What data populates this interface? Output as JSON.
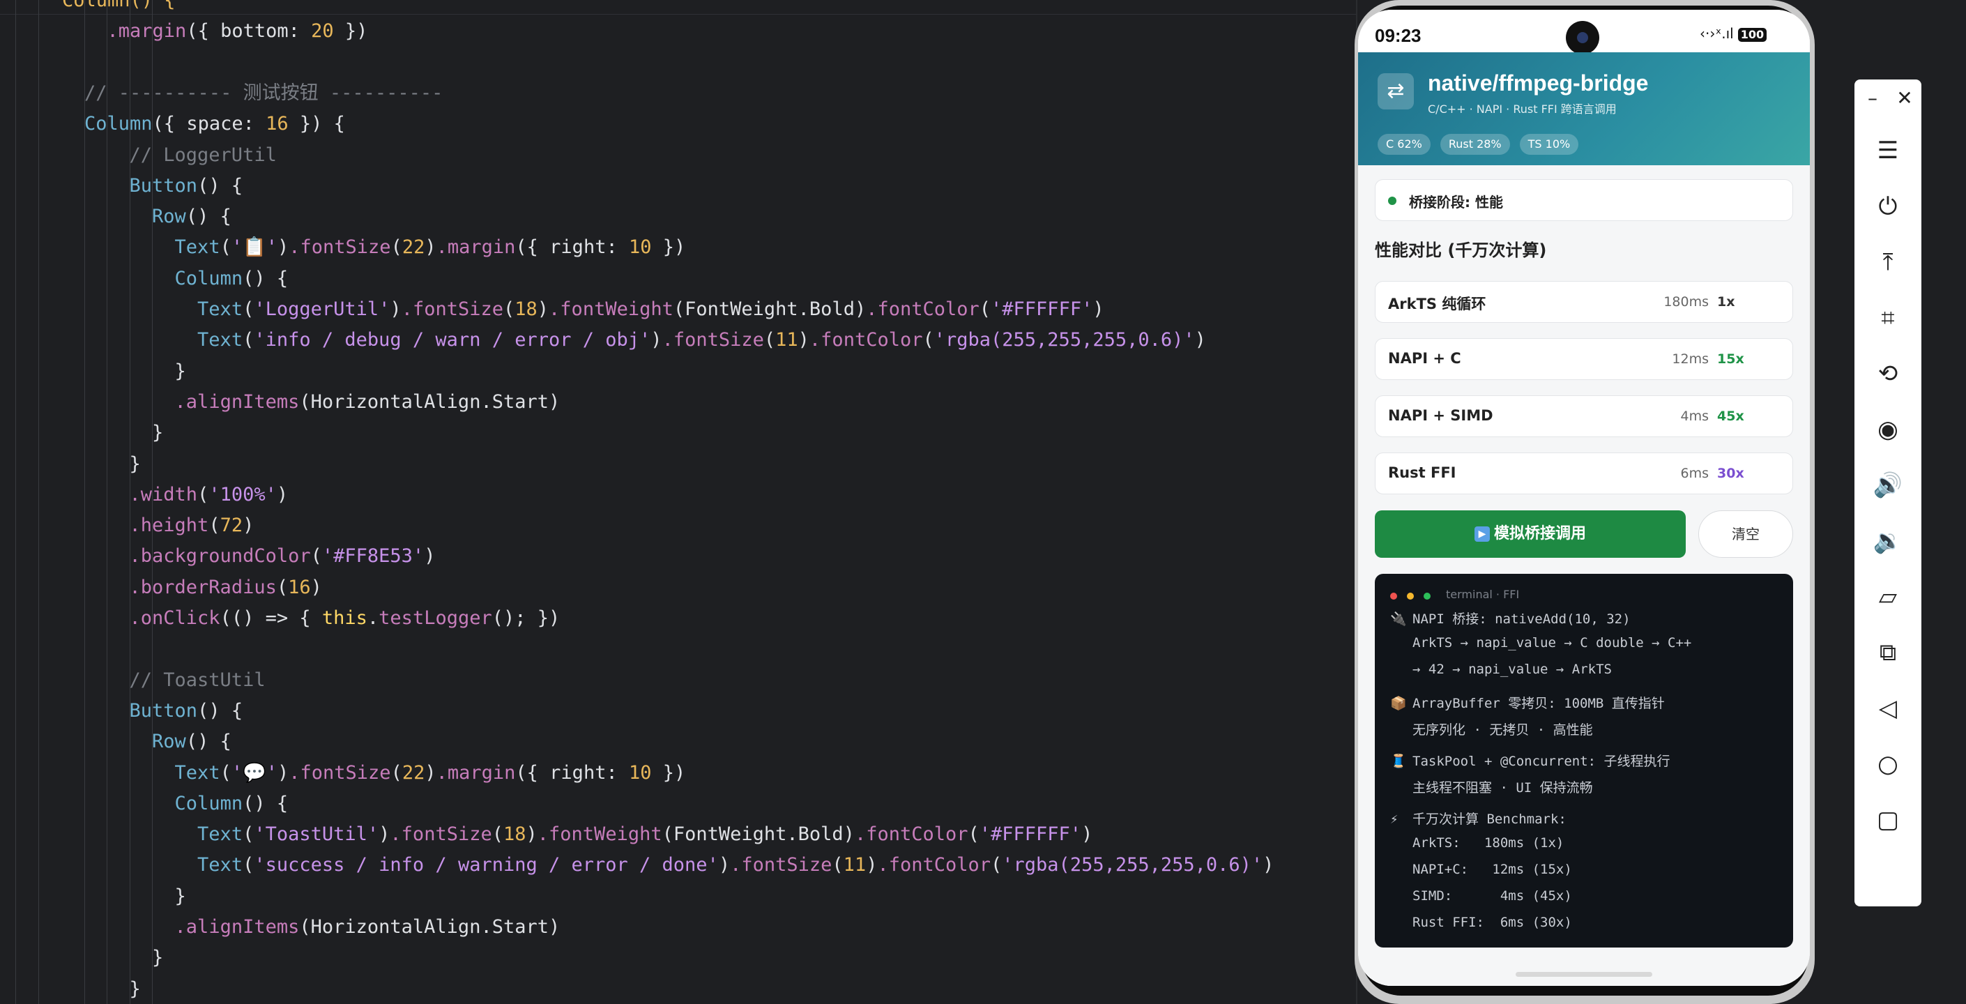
{
  "editor": {
    "lines": [
      [
        [
          "p",
          "Column() {"
        ]
      ],
      [
        [
          "w",
          "  "
        ],
        [
          "m",
          ".margin"
        ],
        [
          "w",
          "({ "
        ],
        [
          "w",
          "bottom"
        ],
        [
          "w",
          ": "
        ],
        [
          "n",
          "20"
        ],
        [
          "w",
          " })"
        ]
      ],
      [],
      [
        [
          "cm",
          "// ---------- 测试按钮 ----------"
        ]
      ],
      [
        [
          "k",
          "Column"
        ],
        [
          "w",
          "({ "
        ],
        [
          "w",
          "space"
        ],
        [
          "w",
          ": "
        ],
        [
          "n",
          "16"
        ],
        [
          "w",
          " }) {"
        ]
      ],
      [
        [
          "cm",
          "  // LoggerUtil"
        ]
      ],
      [
        [
          "w",
          "  "
        ],
        [
          "k",
          "Button"
        ],
        [
          "w",
          "() {"
        ]
      ],
      [
        [
          "w",
          "    "
        ],
        [
          "k",
          "Row"
        ],
        [
          "w",
          "() {"
        ]
      ],
      [
        [
          "w",
          "      "
        ],
        [
          "k",
          "Text"
        ],
        [
          "w",
          "("
        ],
        [
          "str",
          "'📋'"
        ],
        [
          "w",
          ")"
        ],
        [
          "m",
          ".fontSize"
        ],
        [
          "w",
          "("
        ],
        [
          "n",
          "22"
        ],
        [
          "w",
          ")"
        ],
        [
          "m",
          ".margin"
        ],
        [
          "w",
          "({ right: "
        ],
        [
          "n",
          "10"
        ],
        [
          "w",
          " })"
        ]
      ],
      [
        [
          "w",
          "      "
        ],
        [
          "k",
          "Column"
        ],
        [
          "w",
          "() {"
        ]
      ],
      [
        [
          "w",
          "        "
        ],
        [
          "k",
          "Text"
        ],
        [
          "w",
          "("
        ],
        [
          "str",
          "'LoggerUtil'"
        ],
        [
          "w",
          ")"
        ],
        [
          "m",
          ".fontSize"
        ],
        [
          "w",
          "("
        ],
        [
          "n",
          "18"
        ],
        [
          "w",
          ")"
        ],
        [
          "m",
          ".fontWeight"
        ],
        [
          "w",
          "(FontWeight.Bold)"
        ],
        [
          "m",
          ".fontColor"
        ],
        [
          "w",
          "("
        ],
        [
          "str",
          "'#FFFFFF'"
        ],
        [
          "w",
          ")"
        ]
      ],
      [
        [
          "w",
          "        "
        ],
        [
          "k",
          "Text"
        ],
        [
          "w",
          "("
        ],
        [
          "str",
          "'info / debug / warn / error / obj'"
        ],
        [
          "w",
          ")"
        ],
        [
          "m",
          ".fontSize"
        ],
        [
          "w",
          "("
        ],
        [
          "n",
          "11"
        ],
        [
          "w",
          ")"
        ],
        [
          "m",
          ".fontColor"
        ],
        [
          "w",
          "("
        ],
        [
          "str",
          "'rgba(255,255,255,0.6)'"
        ],
        [
          "w",
          ")"
        ]
      ],
      [
        [
          "w",
          "      }"
        ]
      ],
      [
        [
          "w",
          "      "
        ],
        [
          "m",
          ".alignItems"
        ],
        [
          "w",
          "(HorizontalAlign.Start)"
        ]
      ],
      [
        [
          "w",
          "    }"
        ]
      ],
      [
        [
          "w",
          "  }"
        ]
      ],
      [
        [
          "w",
          "  "
        ],
        [
          "m",
          ".width"
        ],
        [
          "w",
          "("
        ],
        [
          "str",
          "'100%'"
        ],
        [
          "w",
          ")"
        ]
      ],
      [
        [
          "w",
          "  "
        ],
        [
          "m",
          ".height"
        ],
        [
          "w",
          "("
        ],
        [
          "n",
          "72"
        ],
        [
          "w",
          ")"
        ]
      ],
      [
        [
          "w",
          "  "
        ],
        [
          "m",
          ".backgroundColor"
        ],
        [
          "w",
          "("
        ],
        [
          "str",
          "'#FF8E53'"
        ],
        [
          "w",
          ")"
        ]
      ],
      [
        [
          "w",
          "  "
        ],
        [
          "m",
          ".borderRadius"
        ],
        [
          "w",
          "("
        ],
        [
          "n",
          "16"
        ],
        [
          "w",
          ")"
        ]
      ],
      [
        [
          "w",
          "  "
        ],
        [
          "m",
          ".onClick"
        ],
        [
          "w",
          "(() => { "
        ],
        [
          "kw",
          "this"
        ],
        [
          "w",
          "."
        ],
        [
          "m",
          "testLogger"
        ],
        [
          "w",
          "(); })"
        ]
      ],
      [],
      [
        [
          "cm",
          "  // ToastUtil"
        ]
      ],
      [
        [
          "w",
          "  "
        ],
        [
          "k",
          "Button"
        ],
        [
          "w",
          "() {"
        ]
      ],
      [
        [
          "w",
          "    "
        ],
        [
          "k",
          "Row"
        ],
        [
          "w",
          "() {"
        ]
      ],
      [
        [
          "w",
          "      "
        ],
        [
          "k",
          "Text"
        ],
        [
          "w",
          "("
        ],
        [
          "str",
          "'💬'"
        ],
        [
          "w",
          ")"
        ],
        [
          "m",
          ".fontSize"
        ],
        [
          "w",
          "("
        ],
        [
          "n",
          "22"
        ],
        [
          "w",
          ")"
        ],
        [
          "m",
          ".margin"
        ],
        [
          "w",
          "({ right: "
        ],
        [
          "n",
          "10"
        ],
        [
          "w",
          " })"
        ]
      ],
      [
        [
          "w",
          "      "
        ],
        [
          "k",
          "Column"
        ],
        [
          "w",
          "() {"
        ]
      ],
      [
        [
          "w",
          "        "
        ],
        [
          "k",
          "Text"
        ],
        [
          "w",
          "("
        ],
        [
          "str",
          "'ToastUtil'"
        ],
        [
          "w",
          ")"
        ],
        [
          "m",
          ".fontSize"
        ],
        [
          "w",
          "("
        ],
        [
          "n",
          "18"
        ],
        [
          "w",
          ")"
        ],
        [
          "m",
          ".fontWeight"
        ],
        [
          "w",
          "(FontWeight.Bold)"
        ],
        [
          "m",
          ".fontColor"
        ],
        [
          "w",
          "("
        ],
        [
          "str",
          "'#FFFFFF'"
        ],
        [
          "w",
          ")"
        ]
      ],
      [
        [
          "w",
          "        "
        ],
        [
          "k",
          "Text"
        ],
        [
          "w",
          "("
        ],
        [
          "str",
          "'success / info / warning / error / done'"
        ],
        [
          "w",
          ")"
        ],
        [
          "m",
          ".fontSize"
        ],
        [
          "w",
          "("
        ],
        [
          "n",
          "11"
        ],
        [
          "w",
          ")"
        ],
        [
          "m",
          ".fontColor"
        ],
        [
          "w",
          "("
        ],
        [
          "str",
          "'rgba(255,255,255,0.6)'"
        ],
        [
          "w",
          ")"
        ]
      ],
      [
        [
          "w",
          "      }"
        ]
      ],
      [
        [
          "w",
          "      "
        ],
        [
          "m",
          ".alignItems"
        ],
        [
          "w",
          "(HorizontalAlign.Start)"
        ]
      ],
      [
        [
          "w",
          "    }"
        ]
      ],
      [
        [
          "w",
          "  }"
        ]
      ]
    ]
  },
  "phone": {
    "status": {
      "time": "09:23",
      "icons": "‹·›ˣ.ıl",
      "battery": "100"
    },
    "header": {
      "title": "native/ffmpeg-bridge",
      "subtitle": "C/C++ · NAPI · Rust FFI 跨语言调用",
      "tags": [
        "C 62%",
        "Rust 28%",
        "TS 10%"
      ]
    },
    "stage": "桥接阶段: 性能",
    "perf_title": "性能对比 (千万次计算)",
    "perf_rows": [
      {
        "name": "ArkTS 纯循环",
        "ms": "180ms",
        "x": "1x",
        "color": "#333333"
      },
      {
        "name": "NAPI + C",
        "ms": "12ms",
        "x": "15x",
        "color": "#1f9347"
      },
      {
        "name": "NAPI + SIMD",
        "ms": "4ms",
        "x": "45x",
        "color": "#1f9347"
      },
      {
        "name": "Rust FFI",
        "ms": "6ms",
        "x": "30x",
        "color": "#7b4fd0"
      }
    ],
    "run_button": "模拟桥接调用",
    "clear_button": "清空",
    "terminal": {
      "title": "terminal · FFI",
      "lines": [
        {
          "icon": "🔌",
          "text": "NAPI 桥接: nativeAdd(10, 32)"
        },
        {
          "icon": "",
          "text": "ArkTS → napi_value → C double → C++"
        },
        {
          "icon": "",
          "text": "→ 42 → napi_value → ArkTS"
        },
        {
          "icon": "📦",
          "text": "ArrayBuffer 零拷贝: 100MB 直传指针"
        },
        {
          "icon": "",
          "text": "无序列化 · 无拷贝 · 高性能"
        },
        {
          "icon": "🧵",
          "text": "TaskPool + @Concurrent: 子线程执行"
        },
        {
          "icon": "",
          "text": "主线程不阻塞 · UI 保持流畅"
        },
        {
          "icon": "⚡",
          "text": "千万次计算 Benchmark:"
        },
        {
          "icon": "",
          "text": "ArkTS:   180ms (1x)"
        },
        {
          "icon": "",
          "text": "NAPI+C:   12ms (15x)"
        },
        {
          "icon": "",
          "text": "SIMD:      4ms (45x)"
        },
        {
          "icon": "",
          "text": "Rust FFI:  6ms (30x)"
        }
      ]
    }
  },
  "toolbar": {
    "items": [
      {
        "name": "minimize-icon",
        "glyph": "–"
      },
      {
        "name": "close-icon",
        "glyph": "✕"
      },
      {
        "name": "menu-icon",
        "glyph": "☰"
      },
      {
        "name": "power-icon",
        "glyph": "⏻"
      },
      {
        "name": "upload-icon",
        "glyph": "⤒"
      },
      {
        "name": "crop-icon",
        "glyph": "⌗"
      },
      {
        "name": "rotate-icon",
        "glyph": "⟲"
      },
      {
        "name": "screen-record-icon",
        "glyph": "◉"
      },
      {
        "name": "volume-up-icon",
        "glyph": "🔊"
      },
      {
        "name": "volume-down-icon",
        "glyph": "🔉"
      },
      {
        "name": "rotate-device-icon",
        "glyph": "▱"
      },
      {
        "name": "multi-device-icon",
        "glyph": "⧉"
      },
      {
        "name": "back-icon",
        "glyph": "◁"
      },
      {
        "name": "home-icon",
        "glyph": "○"
      },
      {
        "name": "recent-apps-icon",
        "glyph": "▢"
      }
    ]
  }
}
